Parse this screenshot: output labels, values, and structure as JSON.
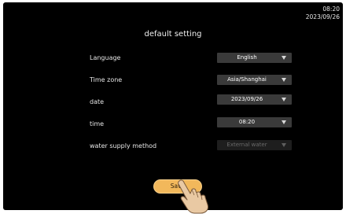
{
  "status": {
    "time": "08:20",
    "date": "2023/09/26"
  },
  "page": {
    "title": "default setting"
  },
  "settings": [
    {
      "label": "Language",
      "value": "English",
      "enabled": true
    },
    {
      "label": "Time zone",
      "value": "Asia/Shanghai",
      "enabled": true
    },
    {
      "label": "date",
      "value": "2023/09/26",
      "enabled": true
    },
    {
      "label": "time",
      "value": "08:20",
      "enabled": true
    },
    {
      "label": "water supply method",
      "value": "External water",
      "enabled": false
    }
  ],
  "actions": {
    "save_label": "Save"
  },
  "colors": {
    "background": "#000000",
    "dropdown": "#3a3a3a",
    "save_button": "#f2b85b"
  },
  "icons": [
    "chevron-down-icon",
    "hand-pointer-icon"
  ]
}
